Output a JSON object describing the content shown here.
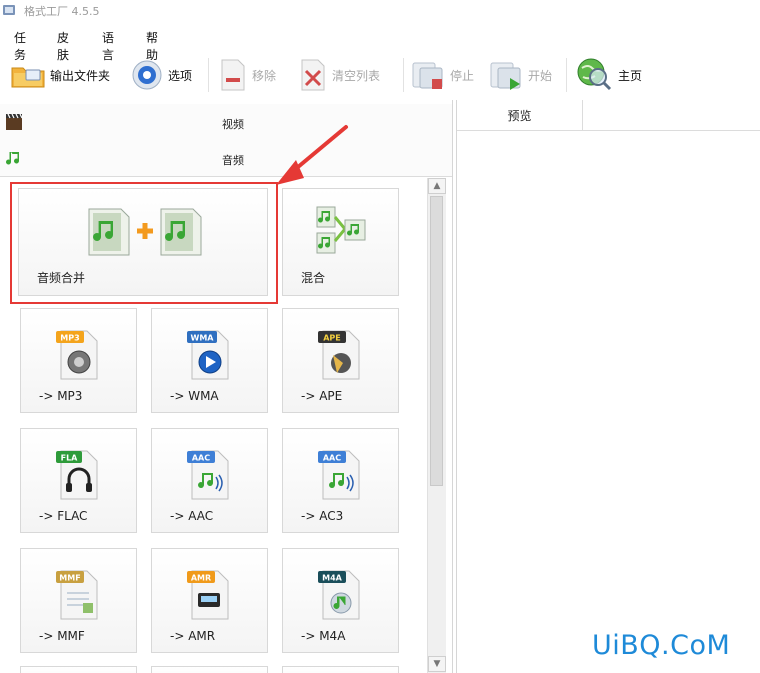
{
  "window": {
    "title": "格式工厂 4.5.5"
  },
  "menu": [
    "任务",
    "皮肤",
    "语言",
    "帮助"
  ],
  "toolbar": {
    "output_folder": "输出文件夹",
    "options": "选项",
    "remove": "移除",
    "clear_list": "清空列表",
    "stop": "停止",
    "start": "开始",
    "home": "主页"
  },
  "categories": {
    "video": "视频",
    "audio": "音频"
  },
  "audio_tools": [
    {
      "label": "音频合并"
    },
    {
      "label": "混合"
    },
    {
      "label": "-> MP3",
      "badge": "MP3",
      "badge_color": "#f4a41c"
    },
    {
      "label": "-> WMA",
      "badge": "WMA",
      "badge_color": "#2f6fc0"
    },
    {
      "label": "-> APE",
      "badge": "APE",
      "badge_color": "#333333"
    },
    {
      "label": "-> FLAC",
      "badge": "FLA",
      "badge_color": "#2e9b3a"
    },
    {
      "label": "-> AAC",
      "badge": "AAC",
      "badge_color": "#3e7fd6"
    },
    {
      "label": "-> AC3",
      "badge": "AAC",
      "badge_color": "#3e7fd6"
    },
    {
      "label": "-> MMF",
      "badge": "MMF",
      "badge_color": "#c8a040"
    },
    {
      "label": "-> AMR",
      "badge": "AMR",
      "badge_color": "#f09a1a"
    },
    {
      "label": "-> M4A",
      "badge": "M4A",
      "badge_color": "#1a4e5a"
    }
  ],
  "preview": {
    "header": "预览"
  },
  "watermark": "UiBQ.CoM",
  "colors": {
    "highlight": "#e53935",
    "watermark": "#1e8ad8",
    "music_note": "#3aa635"
  }
}
